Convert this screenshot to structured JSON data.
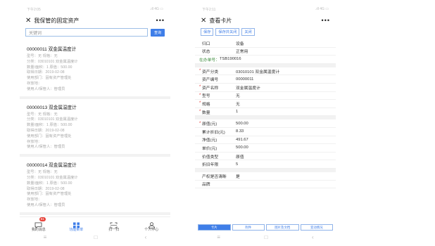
{
  "left": {
    "status_time": "下午2:05",
    "status_icons": ".ıll 4G ▭",
    "title": "我保管的固定资产",
    "search_placeholder": "关键词",
    "search_button": "查询",
    "items": [
      {
        "title": "00000011 双金属温度计",
        "lines": [
          "型号：无 规格：无",
          "分类：03010101 双金属温度计",
          "数量/面积：1 原值：500.00",
          "取得日期：2019-02-08",
          "使用部门：固有资产管理处",
          "存放地：",
          "使用人/保管人：管理员"
        ]
      },
      {
        "title": "00000013 双金属温度计",
        "lines": [
          "型号：无 规格：无",
          "分类：03010101 双金属温度计",
          "数量/面积：1 原值：500.00",
          "取得日期：2019-02-08",
          "使用部门：固有资产管理处",
          "存放地：",
          "使用人/保管人：管理员"
        ]
      },
      {
        "title": "00000014 双金属温度计",
        "lines": [
          "型号：无 规格：无",
          "分类：03010101 双金属温度计",
          "数量/面积：1 原值：500.00",
          "取得日期：2019-02-08",
          "使用部门：固有资产管理处",
          "存放地：",
          "使用人/保管人：管理员"
        ]
      }
    ],
    "tabs": [
      {
        "label": "我的消息",
        "badge": "61"
      },
      {
        "label": "功能菜单"
      },
      {
        "label": "扫一扫"
      },
      {
        "label": "个人中心"
      }
    ],
    "nav": [
      "≡",
      "□",
      "‹"
    ]
  },
  "right": {
    "status_time": "下午2:11",
    "status_icons": ".ıll 4G ▭",
    "title": "查看卡片",
    "toolbar": [
      "保存",
      "保存并关闭",
      "关闭"
    ],
    "rows_top": [
      {
        "label": "归口",
        "value": "设备"
      },
      {
        "label": "状态",
        "value": "正常用"
      }
    ],
    "code_label": "在办单号：",
    "code_value": "TSB190016",
    "rows_a": [
      {
        "label": "资产分类",
        "value": "03010101 双金属温度计",
        "req": true
      },
      {
        "label": "资产编号",
        "value": "00000011",
        "req": false
      },
      {
        "label": "资产名称",
        "value": "双金属温度计",
        "req": true
      },
      {
        "label": "型号",
        "value": "无",
        "req": true
      },
      {
        "label": "规格",
        "value": "无",
        "req": true
      },
      {
        "label": "数量",
        "value": "1",
        "req": true
      }
    ],
    "rows_b": [
      {
        "label": "原值(元)",
        "value": "500.00",
        "req": true
      },
      {
        "label": "累计折旧(元)",
        "value": "8.33",
        "req": false
      },
      {
        "label": "净值(元)",
        "value": "491.67",
        "req": false
      },
      {
        "label": "单价(元)",
        "value": "500.00",
        "req": false
      },
      {
        "label": "价值类型",
        "value": "原值",
        "req": false
      },
      {
        "label": "折旧年限",
        "value": "5",
        "req": false
      }
    ],
    "rows_c": [
      {
        "label": "产权是否清晰",
        "value": "是",
        "req": false
      },
      {
        "label": "品牌",
        "value": "",
        "req": false
      }
    ],
    "bottom_tabs": [
      "卡片",
      "附件",
      "图片及文档",
      "变动情况"
    ],
    "nav": [
      "≡",
      "□",
      "‹"
    ]
  }
}
